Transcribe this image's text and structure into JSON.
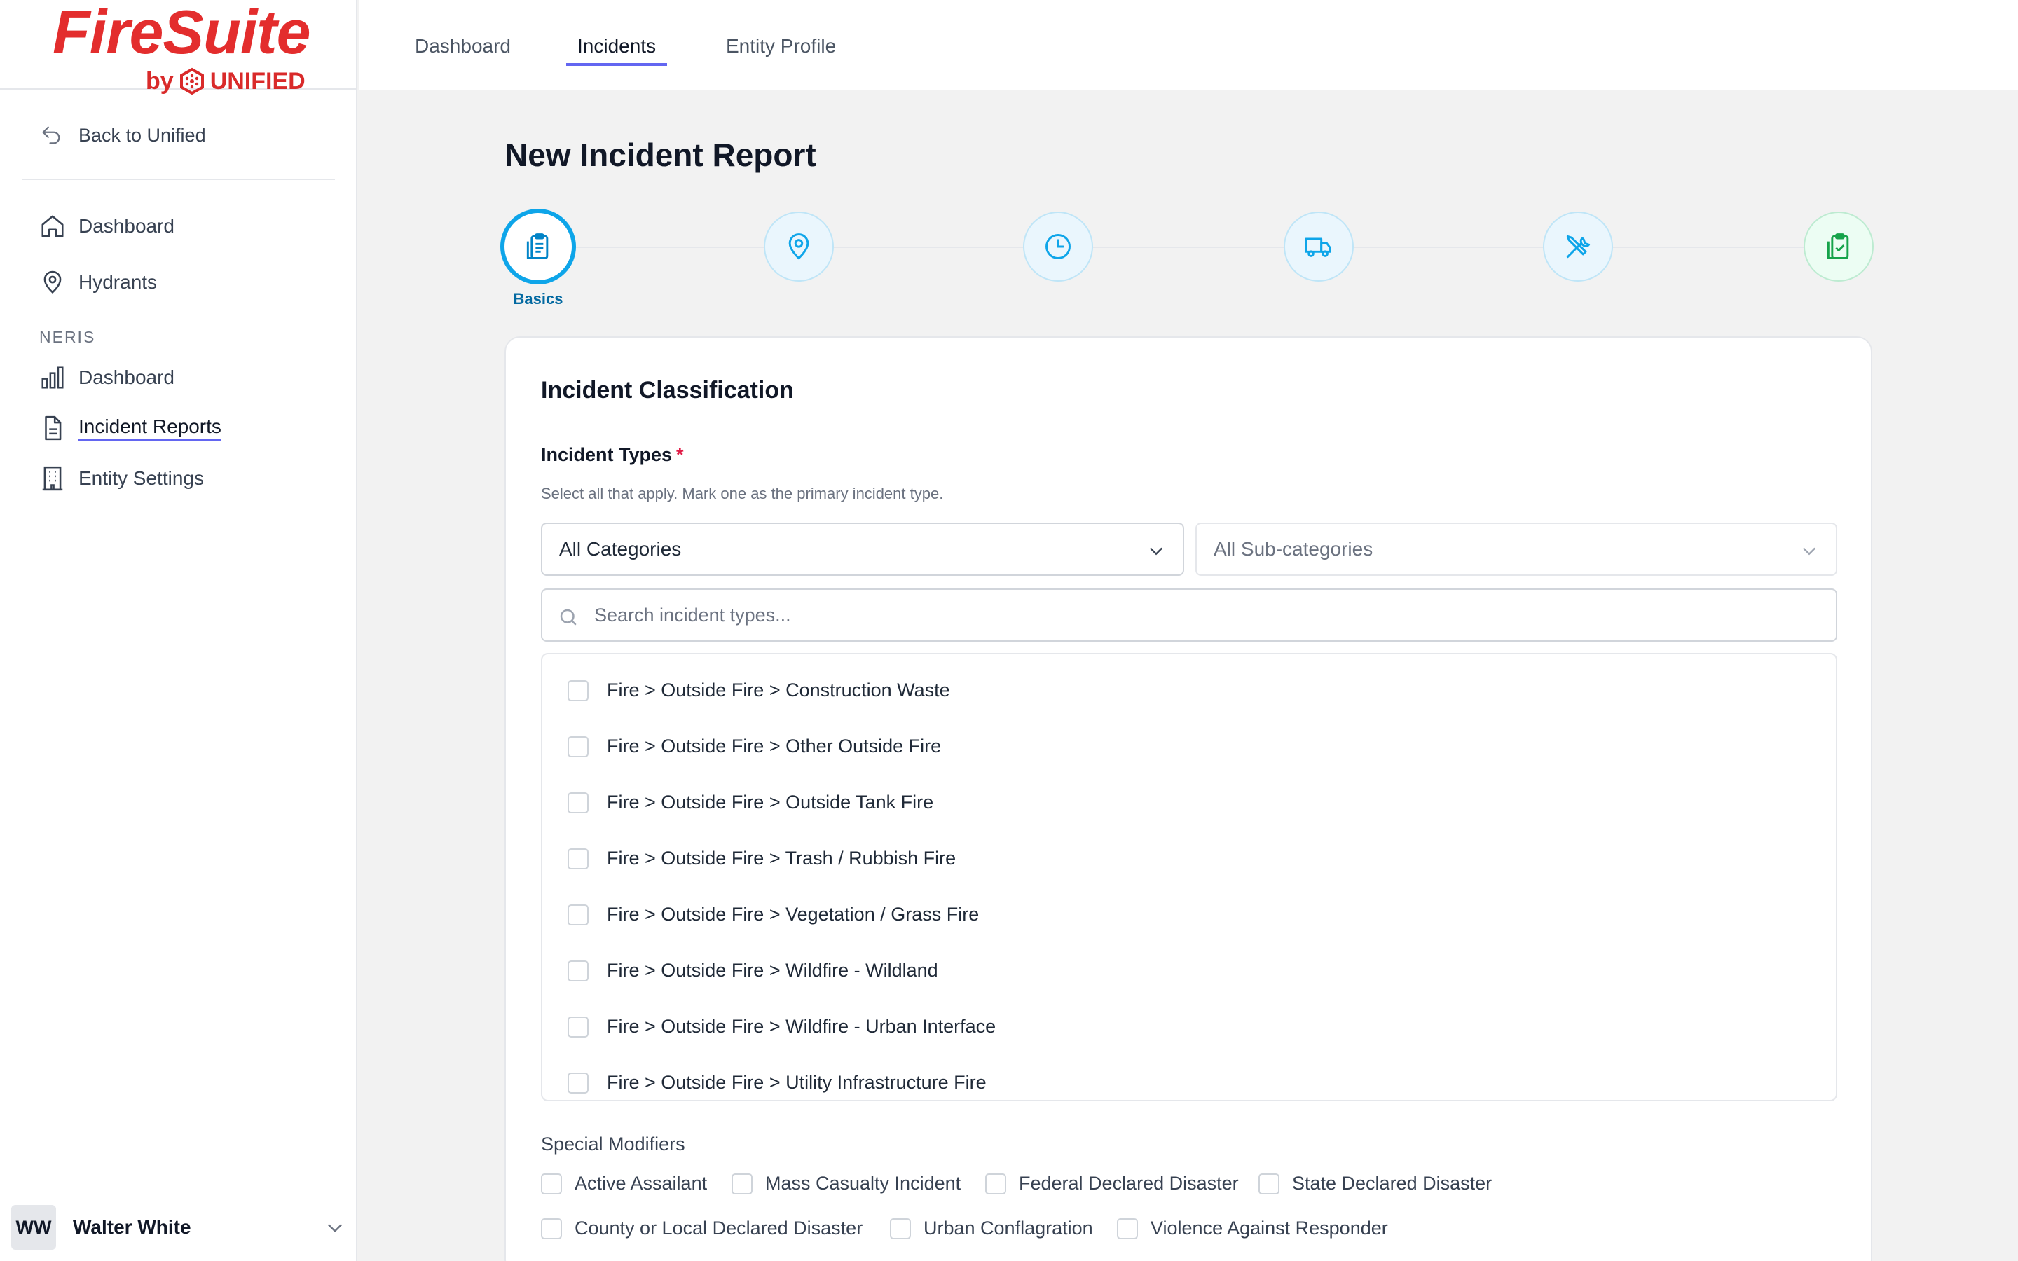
{
  "brand": {
    "title": "FireSuite",
    "by": "by",
    "company": "UNIFIED",
    "color": "#e32d2d"
  },
  "sidebar": {
    "back_label": "Back to Unified",
    "items": [
      {
        "label": "Dashboard",
        "icon": "home-icon"
      },
      {
        "label": "Hydrants",
        "icon": "map-pin-icon"
      }
    ],
    "section_label": "NERIS",
    "neris_items": [
      {
        "label": "Dashboard",
        "icon": "bar-chart-icon"
      },
      {
        "label": "Incident Reports",
        "icon": "document-icon",
        "active": true
      },
      {
        "label": "Entity Settings",
        "icon": "building-icon"
      }
    ],
    "user": {
      "initials": "WW",
      "name": "Walter White"
    }
  },
  "tabs": [
    {
      "label": "Dashboard"
    },
    {
      "label": "Incidents",
      "active": true
    },
    {
      "label": "Entity Profile"
    }
  ],
  "page": {
    "title": "New Incident Report"
  },
  "stepper": {
    "steps": [
      {
        "icon": "clipboard-icon",
        "label": "Basics",
        "active": true
      },
      {
        "icon": "location-icon"
      },
      {
        "icon": "clock-icon"
      },
      {
        "icon": "truck-icon"
      },
      {
        "icon": "tools-icon"
      },
      {
        "icon": "clipboard-check-icon"
      }
    ],
    "accent": "#0ea5e9"
  },
  "form": {
    "card_title": "Incident Classification",
    "types_label": "Incident Types",
    "required_mark": "*",
    "types_hint": "Select all that apply. Mark one as the primary incident type.",
    "category_select": "All Categories",
    "subcategory_select": "All Sub-categories",
    "search_placeholder": "Search incident types...",
    "incident_types": [
      "Fire > Outside Fire > Construction Waste",
      "Fire > Outside Fire > Other Outside Fire",
      "Fire > Outside Fire > Outside Tank Fire",
      "Fire > Outside Fire > Trash / Rubbish Fire",
      "Fire > Outside Fire > Vegetation / Grass Fire",
      "Fire > Outside Fire > Wildfire - Wildland",
      "Fire > Outside Fire > Wildfire - Urban Interface",
      "Fire > Outside Fire > Utility Infrastructure Fire"
    ],
    "modifiers_label": "Special Modifiers",
    "modifiers": [
      "Active Assailant",
      "Mass Casualty Incident",
      "Federal Declared Disaster",
      "State Declared Disaster",
      "County or Local Declared Disaster",
      "Urban Conflagration",
      "Violence Against Responder"
    ]
  }
}
